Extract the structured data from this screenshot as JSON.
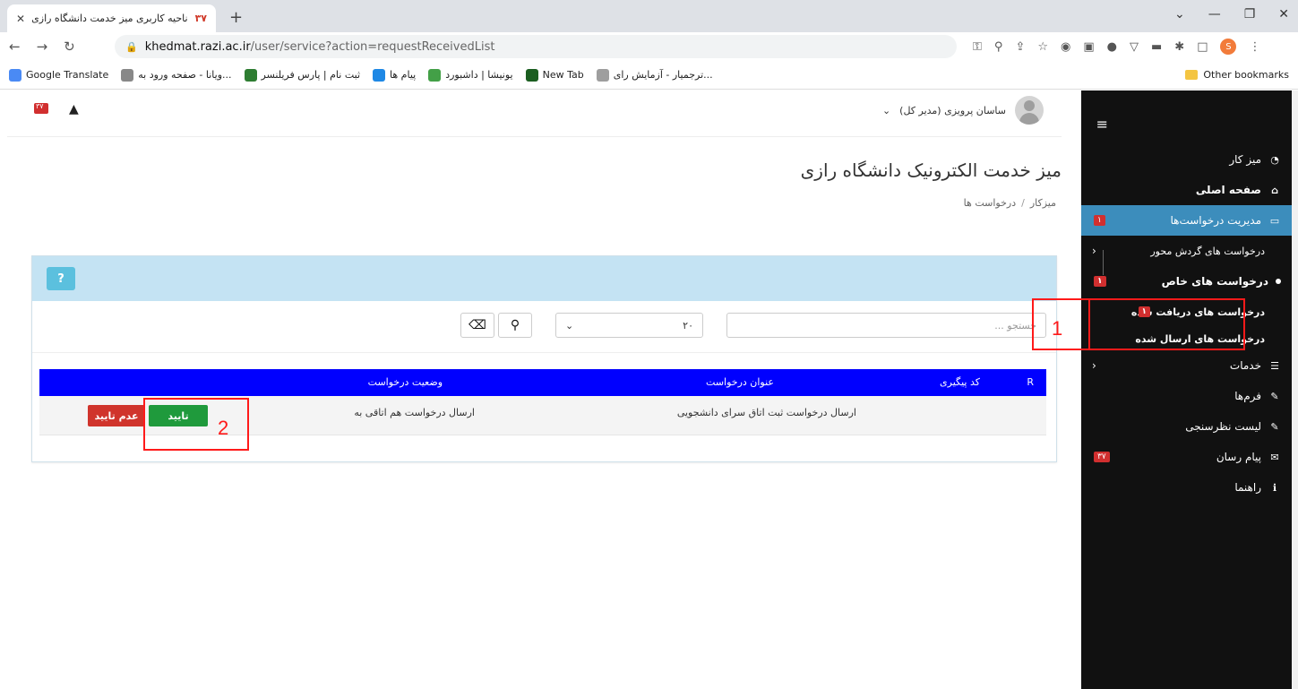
{
  "browser": {
    "tab_title": "ناحیه کاربری میز خدمت دانشگاه رازی",
    "tab_favicon": "۳۷",
    "url_host": "khedmat.razi.ac.ir",
    "url_path": "/user/service?action=requestReceivedList",
    "bookmarks": [
      {
        "label": "Google Translate",
        "color": "#4a8af4"
      },
      {
        "label": "ویانا - صفحه ورود به...",
        "color": "#888888"
      },
      {
        "label": "ثبت نام | پارس فریلنسر",
        "color": "#2e7d32"
      },
      {
        "label": "پیام ها",
        "color": "#1e88e5"
      },
      {
        "label": "یونیشا | داشبورد",
        "color": "#43a047"
      },
      {
        "label": "New Tab",
        "color": "#1b5e20"
      },
      {
        "label": "ترجمیار - آزمایش رای...",
        "color": "#9e9e9e"
      }
    ],
    "other_bookmarks": "Other bookmarks",
    "profile_initial": "S"
  },
  "header": {
    "user_name": "ساسان پرویزی (مدیر کل)",
    "mail_count": "۳۷",
    "page_title": "میز خدمت الکترونیک دانشگاه رازی",
    "breadcrumb": [
      "میزکار",
      "درخواست ها"
    ]
  },
  "sidebar": {
    "items": [
      {
        "label": "میز کار",
        "icon": "dashboard-icon"
      },
      {
        "label": "صفحه اصلی",
        "icon": "home-icon"
      },
      {
        "label": "مدیریت درخواست‌ها",
        "icon": "requests-icon",
        "badge": "۱"
      },
      {
        "label": "درخواست های گردش محور"
      },
      {
        "label": "درخواست های خاص",
        "badge": "۱"
      },
      {
        "label": "درخواست های دریافت شده",
        "badge": "۱"
      },
      {
        "label": "درخواست های ارسال شده"
      },
      {
        "label": "خدمات",
        "icon": "list-icon"
      },
      {
        "label": "فرم‌ها",
        "icon": "edit-icon"
      },
      {
        "label": "لیست نظرسنجی",
        "icon": "edit-icon"
      },
      {
        "label": "پیام رسان",
        "icon": "mail-icon",
        "badge": "۳۷"
      },
      {
        "label": "راهنما",
        "icon": "info-icon"
      }
    ]
  },
  "panel": {
    "help_label": "?",
    "search_placeholder": "جستجو ...",
    "page_size": "۲۰"
  },
  "table": {
    "columns": [
      "R",
      "کد پیگیری",
      "عنوان درخواست",
      "وضعیت درخواست"
    ],
    "rows": [
      {
        "code": "",
        "title": "ارسال درخواست ثبت اتاق سرای دانشجویی",
        "status": "ارسال درخواست هم اتاقی به"
      }
    ],
    "approve_label": "تایید",
    "reject_label": "عدم تایید"
  },
  "annotations": [
    "1",
    "2"
  ],
  "colors": {
    "accent": "#3c8dbc",
    "approve": "#1f9a3c",
    "reject": "#d0342c",
    "table_head": "#0000ff",
    "annotation": "#ff1a1a"
  }
}
